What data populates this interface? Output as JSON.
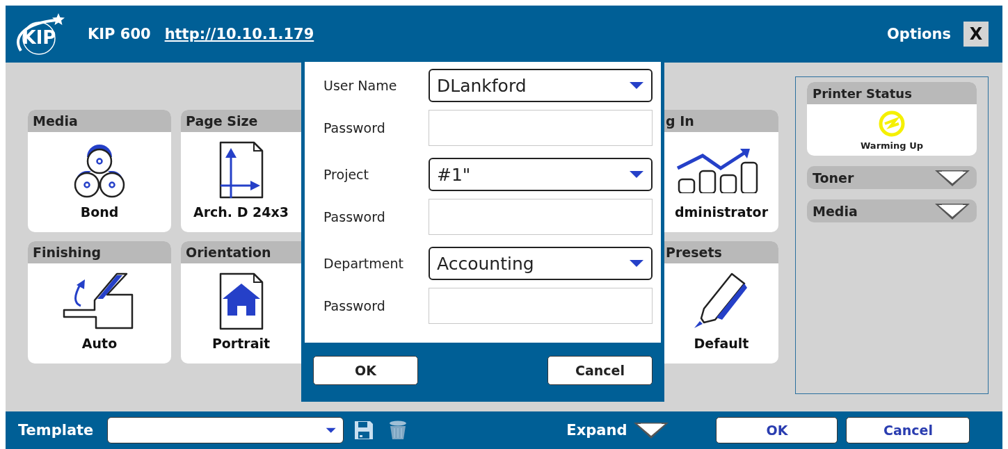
{
  "header": {
    "logo_text": "KIP",
    "model": "KIP 600",
    "url": "http://10.10.1.179",
    "options_label": "Options",
    "close_label": "X"
  },
  "tiles_left": [
    {
      "title": "Media",
      "value": "Bond",
      "kind": "media"
    },
    {
      "title": "Page Size",
      "value": "Arch. D 24x3",
      "kind": "page-size"
    },
    {
      "title": "Finishing",
      "value": "Auto",
      "kind": "finishing"
    },
    {
      "title": "Orientation",
      "value": "Portrait",
      "kind": "orientation"
    }
  ],
  "tiles_right": [
    {
      "title": "g In",
      "value": "dministrator",
      "kind": "login"
    },
    {
      "title": "Presets",
      "value": "Default",
      "kind": "presets"
    }
  ],
  "dialog": {
    "fields": [
      {
        "label": "User Name",
        "kind": "select",
        "value": "DLankford"
      },
      {
        "label": "Password",
        "kind": "password"
      },
      {
        "label": "Project",
        "kind": "select",
        "value": "#1\""
      },
      {
        "label": "Password",
        "kind": "password"
      },
      {
        "label": "Department",
        "kind": "select",
        "value": "Accounting"
      },
      {
        "label": "Password",
        "kind": "password"
      }
    ],
    "buttons": [
      "OK",
      "Cancel"
    ]
  },
  "status_panel": {
    "title": "Printer Status",
    "status": "Warming Up",
    "sections": [
      {
        "label": "Toner",
        "expanded": false
      },
      {
        "label": "Media",
        "expanded": false
      }
    ]
  },
  "footer": {
    "template_label": "Template",
    "expand_label": "Expand",
    "expanded": false,
    "buttons": [
      "OK",
      "Cancel"
    ]
  }
}
